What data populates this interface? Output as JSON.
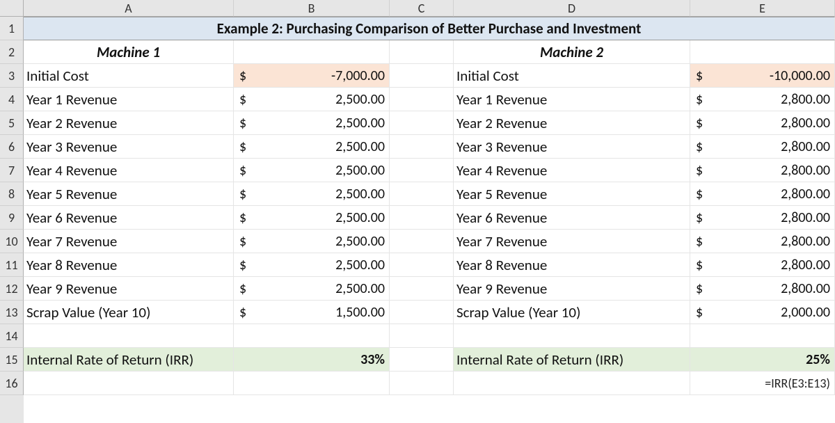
{
  "columns": [
    "A",
    "B",
    "C",
    "D",
    "E"
  ],
  "row_headers": [
    "1",
    "2",
    "3",
    "4",
    "5",
    "6",
    "7",
    "8",
    "9",
    "10",
    "11",
    "12",
    "13",
    "14",
    "15",
    "16"
  ],
  "title": "Example 2: Purchasing Comparison of Better Purchase and Investment",
  "machine1": {
    "header": "Machine 1",
    "rows": [
      {
        "label": "Initial Cost",
        "currency": "$",
        "amount": "-7,000.00",
        "hl": true
      },
      {
        "label": "Year 1 Revenue",
        "currency": "$",
        "amount": "2,500.00"
      },
      {
        "label": "Year 2 Revenue",
        "currency": "$",
        "amount": "2,500.00"
      },
      {
        "label": "Year 3 Revenue",
        "currency": "$",
        "amount": "2,500.00"
      },
      {
        "label": "Year 4 Revenue",
        "currency": "$",
        "amount": "2,500.00"
      },
      {
        "label": "Year 5 Revenue",
        "currency": "$",
        "amount": "2,500.00"
      },
      {
        "label": "Year 6 Revenue",
        "currency": "$",
        "amount": "2,500.00"
      },
      {
        "label": "Year 7 Revenue",
        "currency": "$",
        "amount": "2,500.00"
      },
      {
        "label": "Year 8 Revenue",
        "currency": "$",
        "amount": "2,500.00"
      },
      {
        "label": "Year 9 Revenue",
        "currency": "$",
        "amount": "2,500.00"
      },
      {
        "label": "Scrap Value (Year 10)",
        "currency": "$",
        "amount": "1,500.00"
      }
    ],
    "irr_label": "Internal Rate of Return (IRR)",
    "irr_value": "33%"
  },
  "machine2": {
    "header": "Machine 2",
    "rows": [
      {
        "label": "Initial Cost",
        "currency": "$",
        "amount": "-10,000.00",
        "hl": true
      },
      {
        "label": "Year 1 Revenue",
        "currency": "$",
        "amount": "2,800.00"
      },
      {
        "label": "Year 2 Revenue",
        "currency": "$",
        "amount": "2,800.00"
      },
      {
        "label": "Year 3 Revenue",
        "currency": "$",
        "amount": "2,800.00"
      },
      {
        "label": "Year 4 Revenue",
        "currency": "$",
        "amount": "2,800.00"
      },
      {
        "label": "Year 5 Revenue",
        "currency": "$",
        "amount": "2,800.00"
      },
      {
        "label": "Year 6 Revenue",
        "currency": "$",
        "amount": "2,800.00"
      },
      {
        "label": "Year 7 Revenue",
        "currency": "$",
        "amount": "2,800.00"
      },
      {
        "label": "Year 8 Revenue",
        "currency": "$",
        "amount": "2,800.00"
      },
      {
        "label": "Year 9 Revenue",
        "currency": "$",
        "amount": "2,800.00"
      },
      {
        "label": "Scrap Value (Year 10)",
        "currency": "$",
        "amount": "2,000.00"
      }
    ],
    "irr_label": "Internal Rate of Return (IRR)",
    "irr_value": "25%"
  },
  "formula_hint": "=IRR(E3:E13)"
}
